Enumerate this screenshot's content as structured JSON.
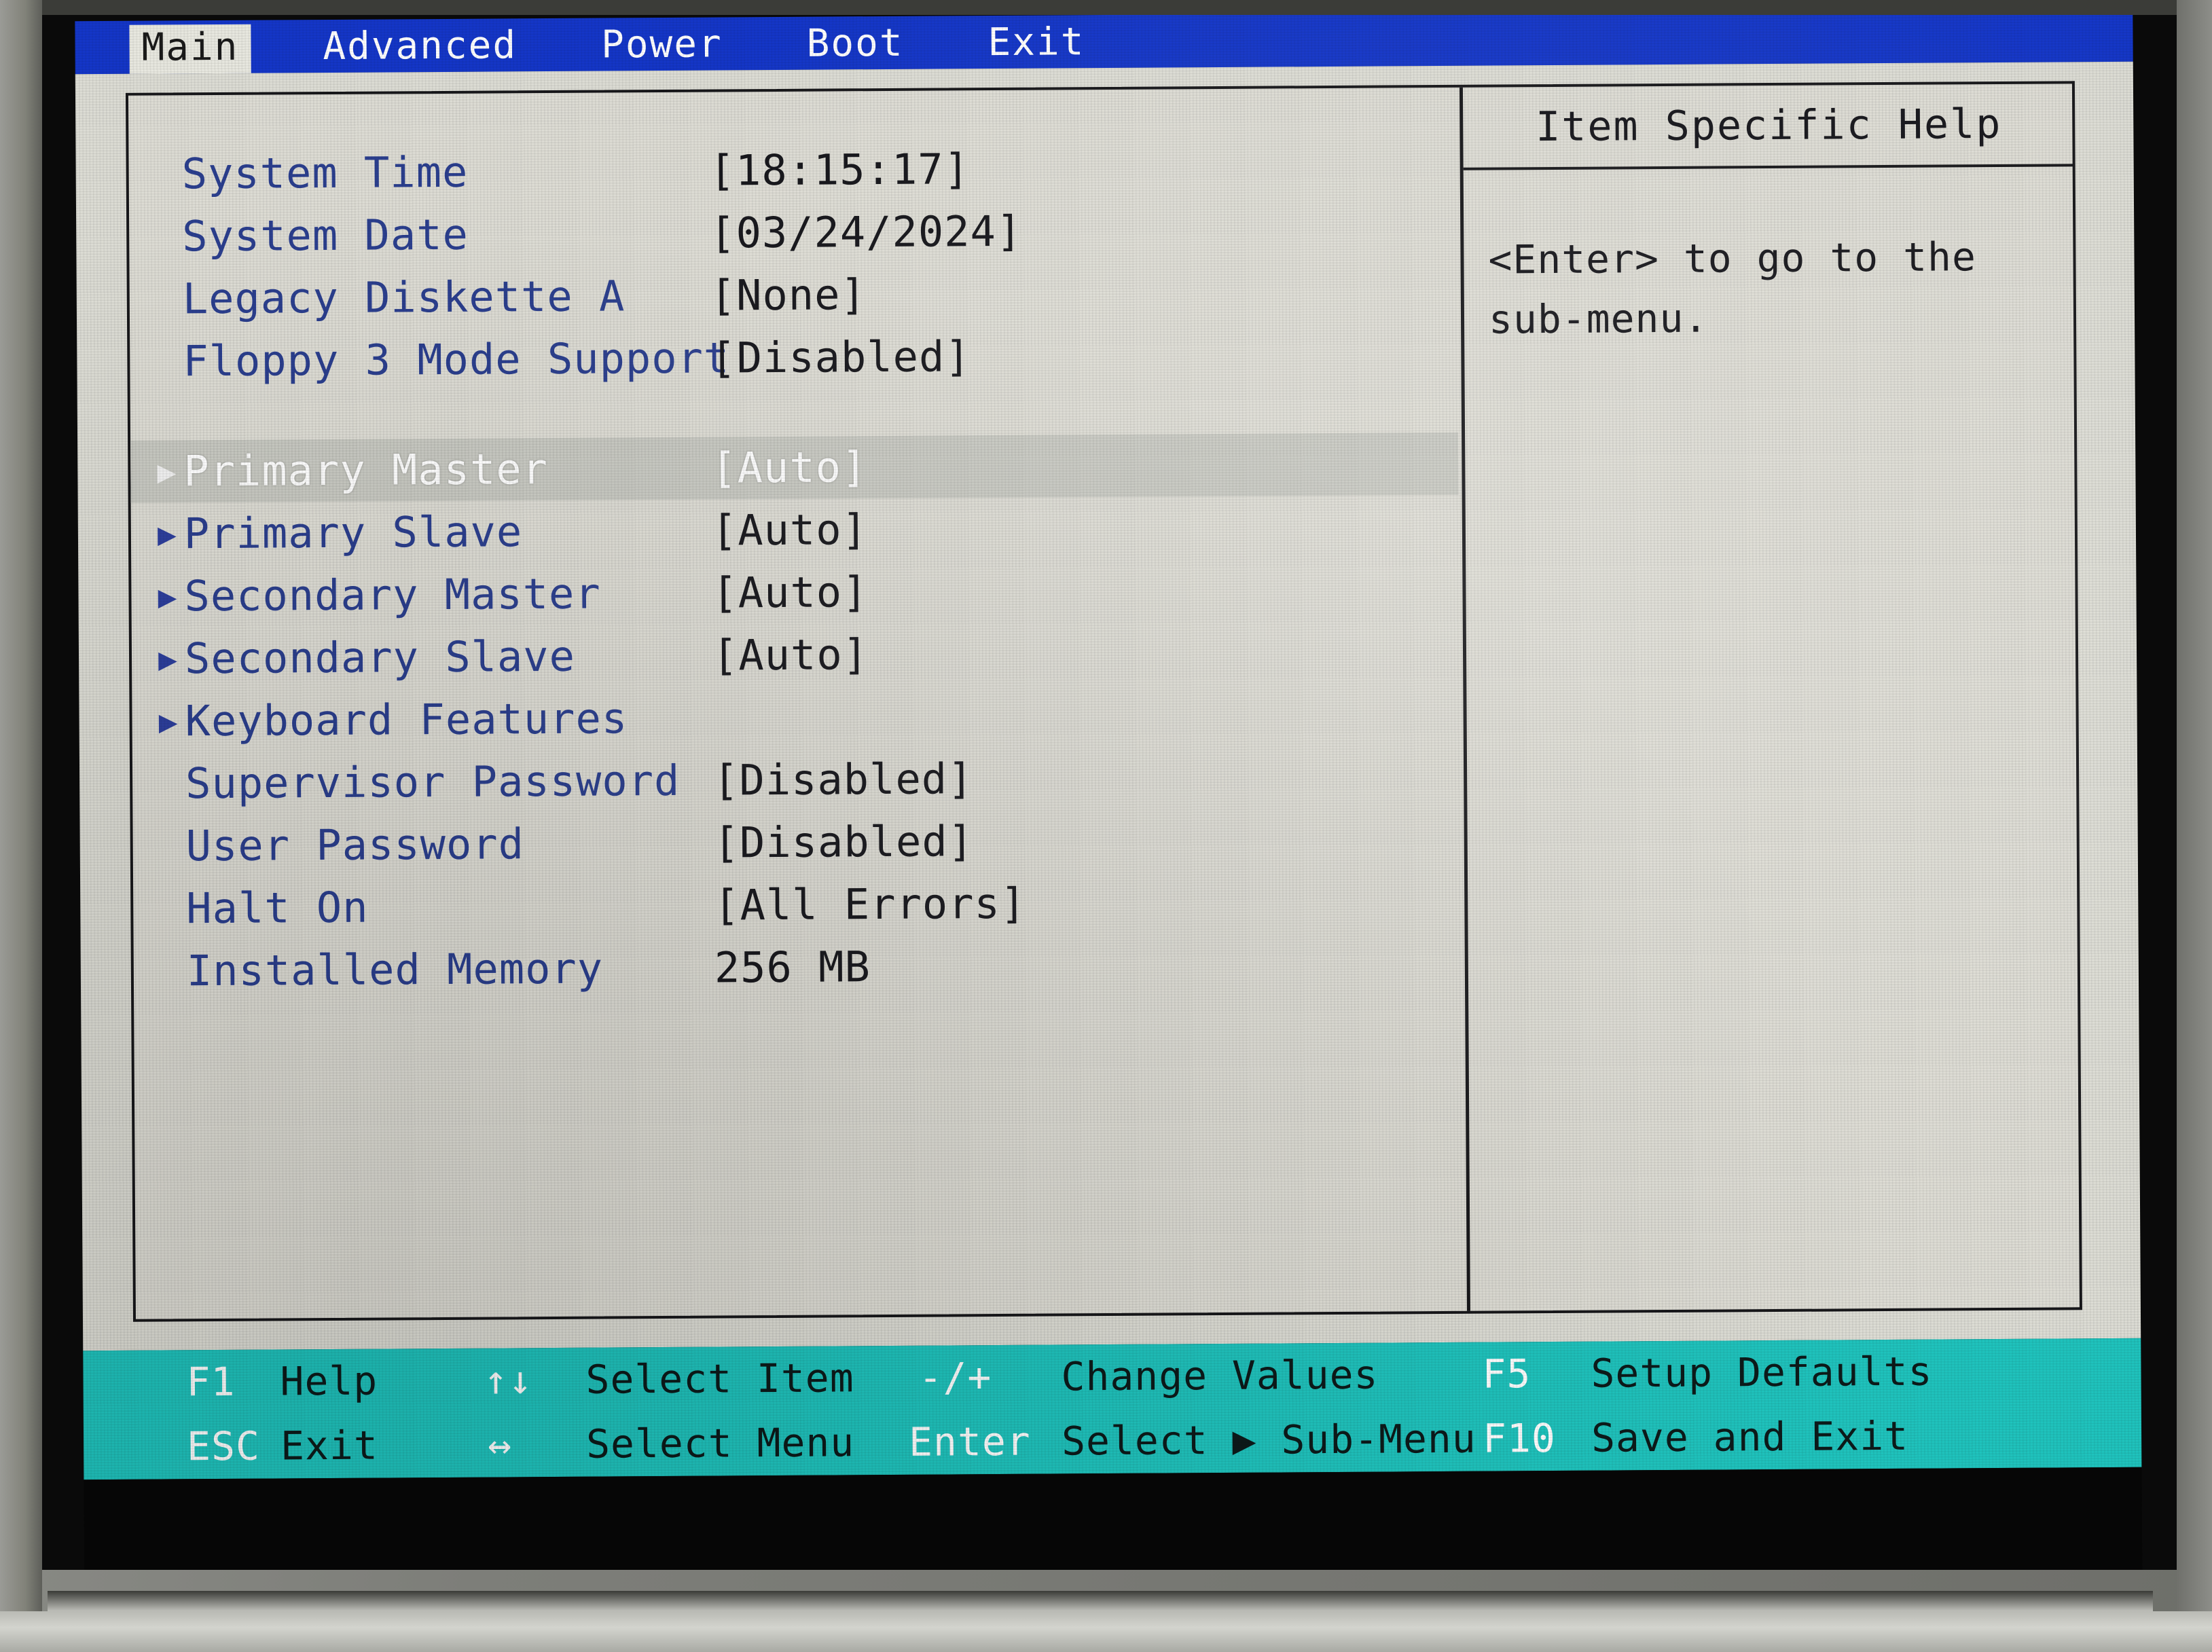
{
  "menu": {
    "tabs": [
      {
        "label": "Main",
        "active": true
      },
      {
        "label": "Advanced",
        "active": false
      },
      {
        "label": "Power",
        "active": false
      },
      {
        "label": "Boot",
        "active": false
      },
      {
        "label": "Exit",
        "active": false
      }
    ]
  },
  "settings": {
    "rows": [
      {
        "label": "System Time",
        "value": "[18:15:17]",
        "arrow": "",
        "selected": false
      },
      {
        "label": "System Date",
        "value": "[03/24/2024]",
        "arrow": "",
        "selected": false
      },
      {
        "label": "Legacy Diskette A",
        "value": "[None]",
        "arrow": "",
        "selected": false
      },
      {
        "label": "Floppy 3 Mode Support",
        "value": "[Disabled]",
        "arrow": "",
        "selected": false
      },
      {
        "label": "Primary Master",
        "value": "[Auto]",
        "arrow": "▶",
        "selected": true
      },
      {
        "label": "Primary Slave",
        "value": "[Auto]",
        "arrow": "▶",
        "selected": false
      },
      {
        "label": "Secondary Master",
        "value": "[Auto]",
        "arrow": "▶",
        "selected": false
      },
      {
        "label": "Secondary Slave",
        "value": "[Auto]",
        "arrow": "▶",
        "selected": false
      },
      {
        "label": "Keyboard Features",
        "value": "",
        "arrow": "▶",
        "selected": false
      },
      {
        "label": "Supervisor Password",
        "value": "[Disabled]",
        "arrow": "",
        "selected": false
      },
      {
        "label": "User Password",
        "value": "[Disabled]",
        "arrow": "",
        "selected": false
      },
      {
        "label": "Halt On",
        "value": "[All Errors]",
        "arrow": "",
        "selected": false
      },
      {
        "label": "Installed Memory",
        "value": "256 MB",
        "arrow": "",
        "selected": false
      }
    ]
  },
  "help": {
    "title": "Item Specific Help",
    "line1": "<Enter> to go to the",
    "line2": "sub-menu."
  },
  "keybar": {
    "row1": [
      {
        "key": "F1",
        "desc": "Help"
      },
      {
        "key": "↑↓",
        "desc": "Select Item"
      },
      {
        "key": "-/+",
        "desc": "Change Values"
      },
      {
        "key": "F5",
        "desc": "Setup Defaults"
      }
    ],
    "row2": [
      {
        "key": "ESC",
        "desc": "Exit"
      },
      {
        "key": "↔",
        "desc": "Select Menu"
      },
      {
        "key": "Enter",
        "desc": "Select ▶ Sub-Menu"
      },
      {
        "key": "F10",
        "desc": "Save and Exit"
      }
    ]
  },
  "colors": {
    "menubar_blue": "#1436c8",
    "label_blue": "#2b3f8f",
    "screen_bg": "#dddcd4",
    "keybar_teal": "#1fc3bd",
    "value_black": "#15151a",
    "selection_bar": "#c8c9c2"
  }
}
